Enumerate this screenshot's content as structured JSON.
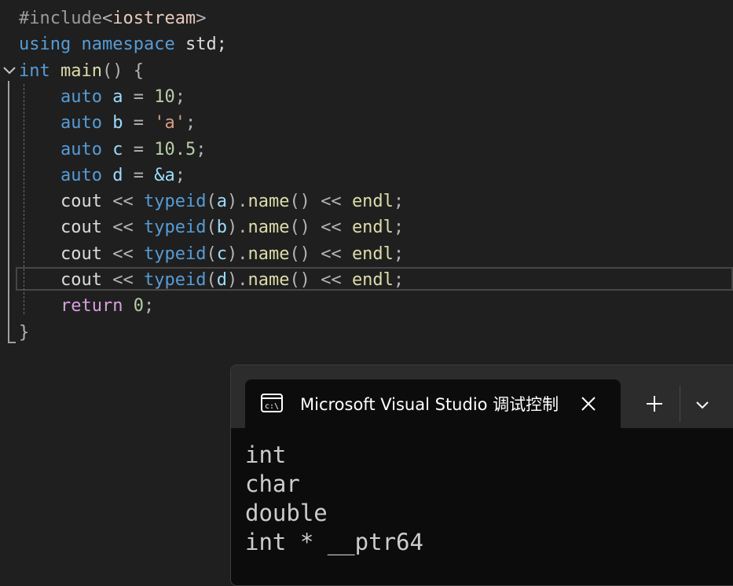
{
  "editor": {
    "lines": [
      [
        {
          "t": "#include",
          "c": "pre"
        },
        {
          "t": "<",
          "c": "pn"
        },
        {
          "t": "iostream",
          "c": "hdr"
        },
        {
          "t": ">",
          "c": "pn"
        }
      ],
      [
        {
          "t": "using",
          "c": "kw"
        },
        {
          "t": " ",
          "c": ""
        },
        {
          "t": "namespace",
          "c": "kw"
        },
        {
          "t": " std;",
          "c": ""
        }
      ],
      [
        {
          "t": "int",
          "c": "kw"
        },
        {
          "t": " ",
          "c": ""
        },
        {
          "t": "main",
          "c": "fn"
        },
        {
          "t": "() {",
          "c": "pn"
        }
      ],
      [
        {
          "t": "    ",
          "c": ""
        },
        {
          "t": "auto",
          "c": "kw"
        },
        {
          "t": " ",
          "c": ""
        },
        {
          "t": "a",
          "c": "var"
        },
        {
          "t": " = ",
          "c": "op"
        },
        {
          "t": "10",
          "c": "num"
        },
        {
          "t": ";",
          "c": "pn"
        }
      ],
      [
        {
          "t": "    ",
          "c": ""
        },
        {
          "t": "auto",
          "c": "kw"
        },
        {
          "t": " ",
          "c": ""
        },
        {
          "t": "b",
          "c": "var"
        },
        {
          "t": " = ",
          "c": "op"
        },
        {
          "t": "'a'",
          "c": "str"
        },
        {
          "t": ";",
          "c": "pn"
        }
      ],
      [
        {
          "t": "    ",
          "c": ""
        },
        {
          "t": "auto",
          "c": "kw"
        },
        {
          "t": " ",
          "c": ""
        },
        {
          "t": "c",
          "c": "var"
        },
        {
          "t": " = ",
          "c": "op"
        },
        {
          "t": "10.5",
          "c": "num"
        },
        {
          "t": ";",
          "c": "pn"
        }
      ],
      [
        {
          "t": "    ",
          "c": ""
        },
        {
          "t": "auto",
          "c": "kw"
        },
        {
          "t": " ",
          "c": ""
        },
        {
          "t": "d",
          "c": "var"
        },
        {
          "t": " = ",
          "c": "op"
        },
        {
          "t": "&a",
          "c": "var"
        },
        {
          "t": ";",
          "c": "pn"
        }
      ],
      [
        {
          "t": "    cout ",
          "c": ""
        },
        {
          "t": "<<",
          "c": "op"
        },
        {
          "t": " ",
          "c": ""
        },
        {
          "t": "typeid",
          "c": "kw"
        },
        {
          "t": "(",
          "c": "pn"
        },
        {
          "t": "a",
          "c": "var"
        },
        {
          "t": ").",
          "c": "pn"
        },
        {
          "t": "name",
          "c": "fn"
        },
        {
          "t": "() ",
          "c": "pn"
        },
        {
          "t": "<<",
          "c": "op"
        },
        {
          "t": " ",
          "c": ""
        },
        {
          "t": "endl",
          "c": "fn"
        },
        {
          "t": ";",
          "c": "pn"
        }
      ],
      [
        {
          "t": "    cout ",
          "c": ""
        },
        {
          "t": "<<",
          "c": "op"
        },
        {
          "t": " ",
          "c": ""
        },
        {
          "t": "typeid",
          "c": "kw"
        },
        {
          "t": "(",
          "c": "pn"
        },
        {
          "t": "b",
          "c": "var"
        },
        {
          "t": ").",
          "c": "pn"
        },
        {
          "t": "name",
          "c": "fn"
        },
        {
          "t": "() ",
          "c": "pn"
        },
        {
          "t": "<<",
          "c": "op"
        },
        {
          "t": " ",
          "c": ""
        },
        {
          "t": "endl",
          "c": "fn"
        },
        {
          "t": ";",
          "c": "pn"
        }
      ],
      [
        {
          "t": "    cout ",
          "c": ""
        },
        {
          "t": "<<",
          "c": "op"
        },
        {
          "t": " ",
          "c": ""
        },
        {
          "t": "typeid",
          "c": "kw"
        },
        {
          "t": "(",
          "c": "pn"
        },
        {
          "t": "c",
          "c": "var"
        },
        {
          "t": ").",
          "c": "pn"
        },
        {
          "t": "name",
          "c": "fn"
        },
        {
          "t": "() ",
          "c": "pn"
        },
        {
          "t": "<<",
          "c": "op"
        },
        {
          "t": " ",
          "c": ""
        },
        {
          "t": "endl",
          "c": "fn"
        },
        {
          "t": ";",
          "c": "pn"
        }
      ],
      [
        {
          "t": "    cout ",
          "c": ""
        },
        {
          "t": "<<",
          "c": "op"
        },
        {
          "t": " ",
          "c": ""
        },
        {
          "t": "typeid",
          "c": "kw"
        },
        {
          "t": "(",
          "c": "pn"
        },
        {
          "t": "d",
          "c": "var"
        },
        {
          "t": ").",
          "c": "pn"
        },
        {
          "t": "name",
          "c": "fn"
        },
        {
          "t": "() ",
          "c": "pn"
        },
        {
          "t": "<<",
          "c": "op"
        },
        {
          "t": " ",
          "c": ""
        },
        {
          "t": "endl",
          "c": "fn"
        },
        {
          "t": ";",
          "c": "pn"
        }
      ],
      [
        {
          "t": "    ",
          "c": ""
        },
        {
          "t": "return",
          "c": "ctl"
        },
        {
          "t": " ",
          "c": ""
        },
        {
          "t": "0",
          "c": "num"
        },
        {
          "t": ";",
          "c": "pn"
        }
      ],
      [
        {
          "t": "}",
          "c": "pn"
        }
      ]
    ],
    "current_line": 10
  },
  "console": {
    "tab_title": "Microsoft Visual Studio 调试控制台",
    "tab_icon": "terminal-icon",
    "close_icon": "close-icon",
    "new_tab_icon": "plus-icon",
    "dropdown_icon": "chevron-down-icon",
    "output": "int\nchar\ndouble\nint * __ptr64"
  },
  "colors": {
    "editor_bg": "#1f1f1f",
    "keyword": "#569cd6",
    "function": "#dcdcaa",
    "variable": "#9cdcfe",
    "number": "#b5cea8",
    "string": "#d69d85",
    "control": "#d8a0df",
    "console_bg": "#0c0c0c",
    "console_title_bg": "#2c2c2c"
  }
}
